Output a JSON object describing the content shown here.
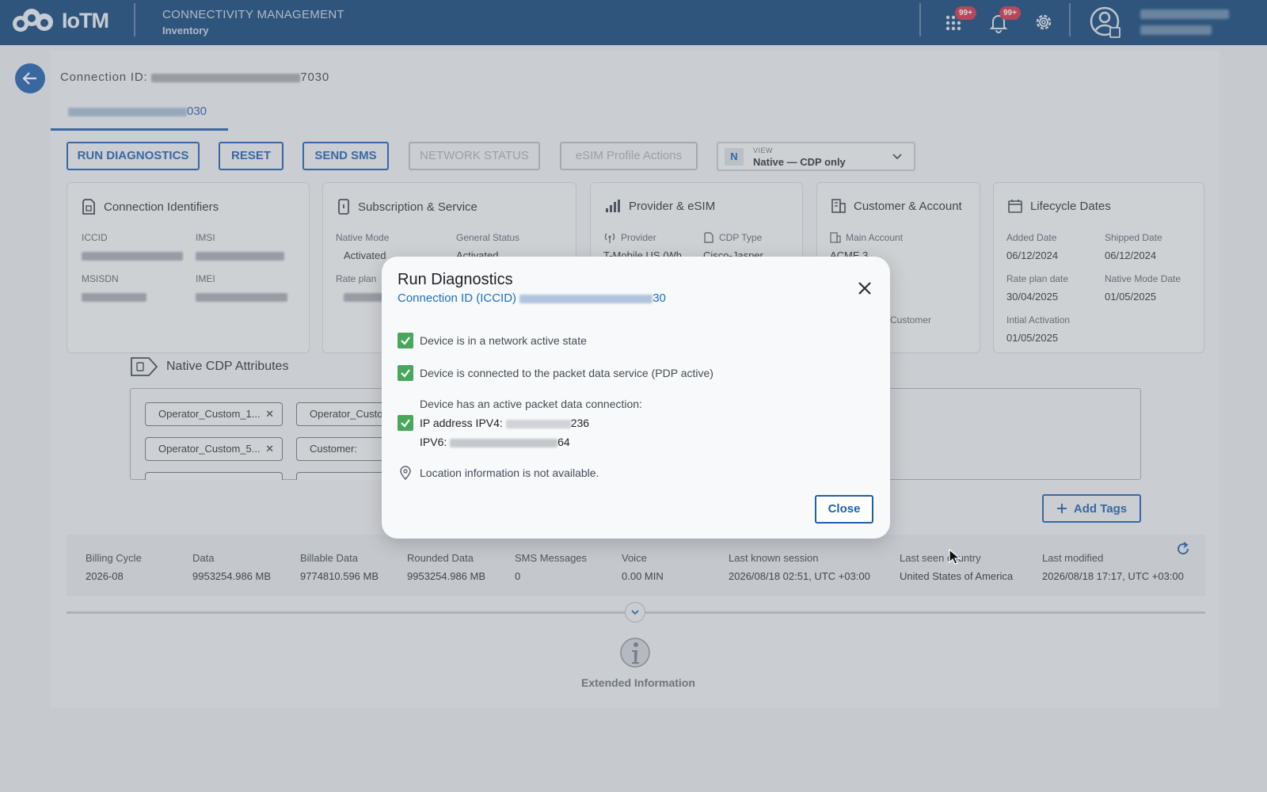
{
  "header": {
    "logo_text": "IoTM",
    "section_title": "CONNECTIVITY MANAGEMENT",
    "section_subtitle": "Inventory",
    "apps_badge": "99+",
    "notifications_badge": "99+"
  },
  "connection": {
    "id_label": "Connection ID:",
    "id_suffix": "7030",
    "tab_suffix": "030"
  },
  "actions": {
    "run_diagnostics": "RUN DIAGNOSTICS",
    "reset": "RESET",
    "send_sms": "SEND SMS",
    "network_status": "NETWORK STATUS",
    "esim_profile_actions": "eSIM Profile Actions",
    "view_badge": "N",
    "view_label": "VIEW",
    "view_value": "Native — CDP only"
  },
  "cards": {
    "identifiers": {
      "title": "Connection Identifiers",
      "iccid_label": "ICCID",
      "imsi_label": "IMSI",
      "msisdn_label": "MSISDN",
      "imei_label": "IMEI"
    },
    "subscription": {
      "title": "Subscription & Service",
      "native_mode_label": "Native Mode",
      "native_mode_value": "Activated",
      "general_status_label": "General Status",
      "general_status_value": "Activated",
      "rate_plan_label": "Rate plan"
    },
    "provider": {
      "title": "Provider & eSIM",
      "provider_label": "Provider",
      "provider_value": "T-Mobile US (Wh...",
      "cdp_type_label": "CDP Type",
      "cdp_type_value": "Cisco-Jasper"
    },
    "customer": {
      "title": "Customer & Account",
      "main_account_label": "Main Account",
      "main_account_value": "ACME 3",
      "customer_label": "Customer"
    },
    "lifecycle": {
      "title": "Lifecycle Dates",
      "added_label": "Added Date",
      "added_value": "06/12/2024",
      "shipped_label": "Shipped Date",
      "shipped_value": "06/12/2024",
      "rate_plan_date_label": "Rate plan date",
      "rate_plan_date_value": "30/04/2025",
      "native_mode_date_label": "Native Mode Date",
      "native_mode_date_value": "01/05/2025",
      "initial_activation_label": "Intial Activation",
      "initial_activation_value": "01/05/2025"
    }
  },
  "cdp": {
    "title": "Native CDP Attributes",
    "chips": [
      "Operator_Custom_1...",
      "Operator_Custo",
      "Operator_Custom_5...",
      "Customer:"
    ],
    "add_tags": "Add Tags"
  },
  "usage": {
    "columns": [
      {
        "label": "Billing Cycle",
        "value": "2026-08"
      },
      {
        "label": "Data",
        "value": "9953254.986 MB"
      },
      {
        "label": "Billable Data",
        "value": "9774810.596 MB"
      },
      {
        "label": "Rounded Data",
        "value": "9953254.986 MB"
      },
      {
        "label": "SMS Messages",
        "value": "0"
      },
      {
        "label": "Voice",
        "value": "0.00 MIN"
      },
      {
        "label": "Last known session",
        "value": "2026/08/18 02:51, UTC +03:00"
      },
      {
        "label": "Last seen country",
        "value": "United States of America"
      },
      {
        "label": "Last modified",
        "value": "2026/08/18 17:17, UTC +03:00"
      }
    ]
  },
  "extended_info": "Extended Information",
  "modal": {
    "title": "Run Diagnostics",
    "subtitle_prefix": "Connection ID (ICCID)",
    "subtitle_suffix": "30",
    "check1": "Device is in a network active state",
    "check2": "Device is connected to the packet data service (PDP active)",
    "check3_heading": "Device has an active packet data connection:",
    "ipv4_label": "IP address IPV4:",
    "ipv4_suffix": "236",
    "ipv6_label": "IPV6:",
    "ipv6_suffix": "64",
    "location": "Location information is not available.",
    "close": "Close"
  },
  "colors": {
    "header_bg": "#10447a",
    "primary": "#1f5fae",
    "success": "#4aa65a",
    "badge": "#d0324a"
  }
}
